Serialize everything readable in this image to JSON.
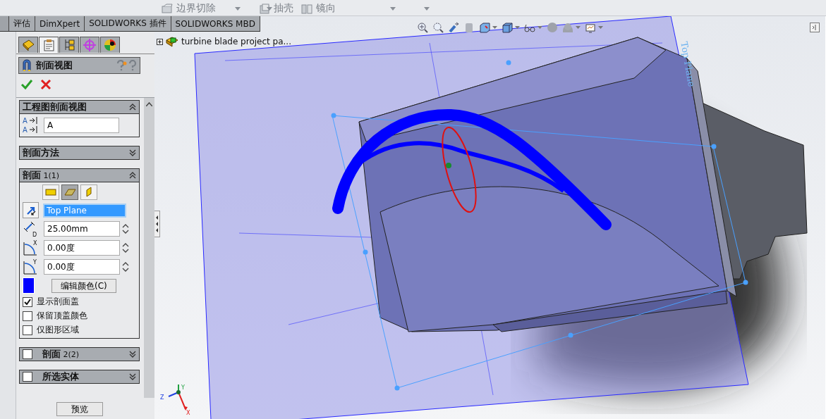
{
  "ribbon": {
    "commands": [
      {
        "label": "边界切除"
      },
      {
        "label": "抽壳"
      },
      {
        "label": "镜向"
      }
    ]
  },
  "command_tabs": [
    {
      "label": "评估",
      "selected": false
    },
    {
      "label": "DimXpert",
      "selected": false
    },
    {
      "label": "SOLIDWORKS 插件",
      "selected": false
    },
    {
      "label": "SOLIDWORKS MBD",
      "selected": false
    }
  ],
  "panel_tabs": [
    {
      "selected": false
    },
    {
      "selected": true
    },
    {
      "selected": false
    },
    {
      "selected": false
    },
    {
      "selected": false
    }
  ],
  "property_manager": {
    "title": "剖面视图",
    "groups": [
      {
        "title": "工程图剖面视图",
        "expanded": true,
        "rows": [
          {
            "kind": "label-field",
            "icon_letters": [
              "A",
              "A"
            ],
            "value": "A"
          }
        ]
      },
      {
        "title": "剖面方法",
        "expanded": false
      },
      {
        "title": "剖面",
        "suffix": "1(1)",
        "expanded": true,
        "rows": [
          {
            "kind": "plane-buttons",
            "buttons": [
              {
                "selected": false
              },
              {
                "selected": true
              },
              {
                "selected": false
              }
            ]
          },
          {
            "kind": "reference",
            "value": "Top Plane",
            "selected": true
          },
          {
            "kind": "distance",
            "axis": "D",
            "value": "25.00mm"
          },
          {
            "kind": "angle",
            "axis": "X",
            "value": "0.00度"
          },
          {
            "kind": "angle",
            "axis": "Y",
            "value": "0.00度"
          },
          {
            "kind": "color",
            "color": "#0000ff",
            "button": "编辑颜色(C)"
          },
          {
            "kind": "checkbox",
            "label": "显示剖面盖",
            "checked": true
          },
          {
            "kind": "checkbox",
            "label": "保留顶盖颜色",
            "checked": false
          },
          {
            "kind": "checkbox",
            "label": "仅图形区域",
            "checked": false
          }
        ]
      },
      {
        "title": "剖面",
        "suffix": "2(2)",
        "expanded": false,
        "checked": false
      },
      {
        "title": "所选实体",
        "expanded": false,
        "checked": false
      }
    ],
    "preview_button": "预览"
  },
  "viewport": {
    "tree_item": "turbine blade project pa...",
    "plane_label": "Top Plane",
    "triad": {
      "x": "X",
      "y": "Y",
      "z": "Z"
    }
  }
}
